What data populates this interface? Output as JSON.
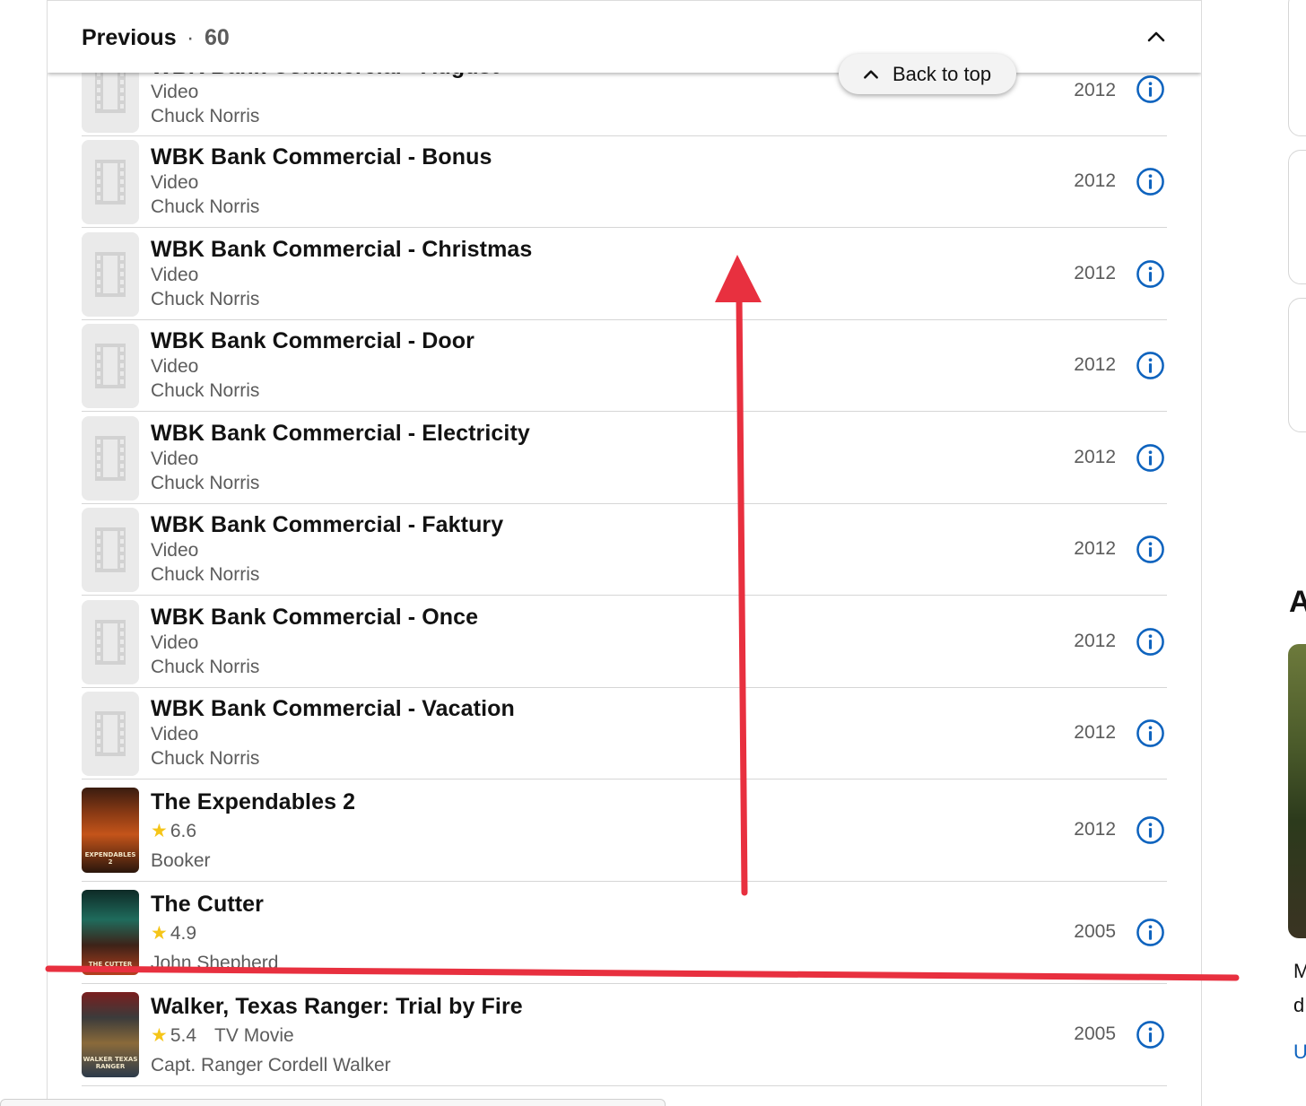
{
  "section": {
    "label": "Previous",
    "separator": "·",
    "count": "60",
    "collapse_icon": "chevron-up-icon"
  },
  "back_to_top": {
    "label": "Back to top",
    "icon": "chevron-up-icon"
  },
  "partial_row": {
    "title": "WBK Bank Commercial - August",
    "kind": "Video",
    "role": "Chuck Norris",
    "year": "2012"
  },
  "rows": [
    {
      "title": "WBK Bank Commercial - Bonus",
      "kind": "Video",
      "role": "Chuck Norris",
      "year": "2012"
    },
    {
      "title": "WBK Bank Commercial - Christmas",
      "kind": "Video",
      "role": "Chuck Norris",
      "year": "2012"
    },
    {
      "title": "WBK Bank Commercial - Door",
      "kind": "Video",
      "role": "Chuck Norris",
      "year": "2012"
    },
    {
      "title": "WBK Bank Commercial - Electricity",
      "kind": "Video",
      "role": "Chuck Norris",
      "year": "2012"
    },
    {
      "title": "WBK Bank Commercial - Faktury",
      "kind": "Video",
      "role": "Chuck Norris",
      "year": "2012"
    },
    {
      "title": "WBK Bank Commercial - Once",
      "kind": "Video",
      "role": "Chuck Norris",
      "year": "2012"
    },
    {
      "title": "WBK Bank Commercial - Vacation",
      "kind": "Video",
      "role": "Chuck Norris",
      "year": "2012"
    }
  ],
  "rated_rows": [
    {
      "title": "The Expendables 2",
      "rating": "6.6",
      "kind": "",
      "role": "Booker",
      "year": "2012",
      "poster_text": "EXPENDABLES 2"
    },
    {
      "title": "The Cutter",
      "rating": "4.9",
      "kind": "",
      "role": "John Shepherd",
      "year": "2005",
      "poster_text": "THE CUTTER"
    },
    {
      "title": "Walker, Texas Ranger: Trial by Fire",
      "rating": "5.4",
      "kind": "TV Movie",
      "role": "Capt. Ranger Cordell Walker",
      "year": "2005",
      "poster_text": "WALKER TEXAS RANGER"
    }
  ],
  "sidebar": {
    "heading_partial": "A",
    "text_line1": "M",
    "text_line2": "d",
    "link_partial": "U"
  },
  "colors": {
    "info_blue": "#0e63be",
    "star": "#f5c518",
    "annotation_red": "#e8303f",
    "muted_text": "#5c5c5c"
  },
  "icons": {
    "info": "info-circle-icon",
    "placeholder": "film-strip-icon",
    "star": "star-icon"
  }
}
